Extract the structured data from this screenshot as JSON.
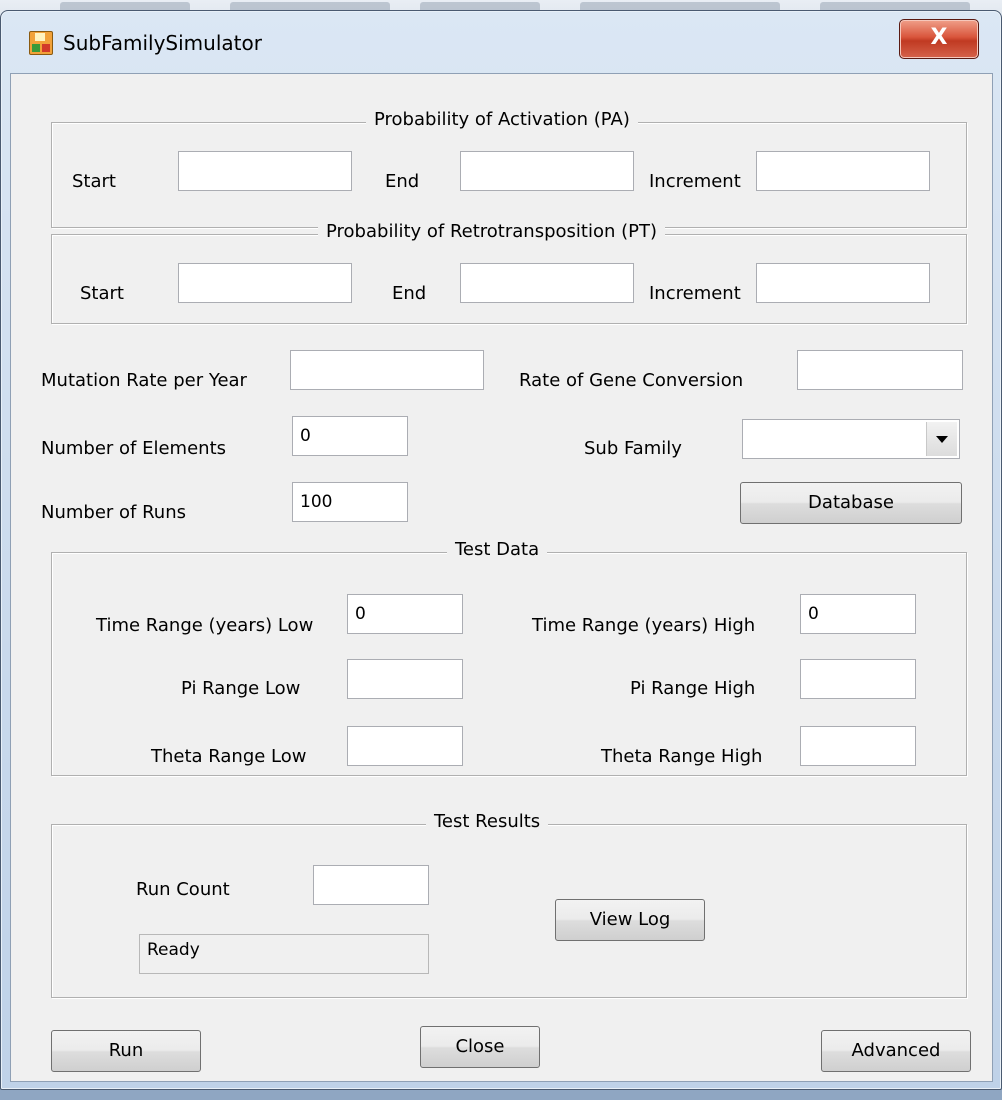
{
  "window": {
    "title": "SubFamilySimulator",
    "close_symbol": "X"
  },
  "pa_group": {
    "title": "Probability of Activation (PA)",
    "start_label": "Start",
    "start_value": "",
    "end_label": "End",
    "end_value": "",
    "increment_label": "Increment",
    "increment_value": ""
  },
  "pt_group": {
    "title": "Probability of Retrotransposition (PT)",
    "start_label": "Start",
    "start_value": "",
    "end_label": "End",
    "end_value": "",
    "increment_label": "Increment",
    "increment_value": ""
  },
  "params": {
    "mutation_label": "Mutation Rate per Year",
    "mutation_value": "",
    "gene_conversion_label": "Rate of Gene Conversion",
    "gene_conversion_value": "",
    "elements_label": "Number of Elements",
    "elements_value": "0",
    "subfamily_label": "Sub Family",
    "subfamily_value": "",
    "runs_label": "Number of Runs",
    "runs_value": "100",
    "database_button": "Database"
  },
  "test_data": {
    "title": "Test Data",
    "time_low_label": "Time Range (years) Low",
    "time_low_value": "0",
    "time_high_label": "Time Range (years) High",
    "time_high_value": "0",
    "pi_low_label": "Pi Range Low",
    "pi_low_value": "",
    "pi_high_label": "Pi Range High",
    "pi_high_value": "",
    "theta_low_label": "Theta Range Low",
    "theta_low_value": "",
    "theta_high_label": "Theta Range High",
    "theta_high_value": ""
  },
  "test_results": {
    "title": "Test Results",
    "run_count_label": "Run Count",
    "run_count_value": "",
    "status_value": "Ready",
    "view_log_button": "View Log"
  },
  "footer": {
    "run_button": "Run",
    "close_button": "Close",
    "advanced_button": "Advanced"
  },
  "colors": {
    "window_frame": "#c9d9ec",
    "client_bg": "#f0f0f0",
    "close_button": "#c8422a"
  },
  "icons": {
    "app": "app-icon",
    "dropdown": "chevron-down-icon"
  }
}
